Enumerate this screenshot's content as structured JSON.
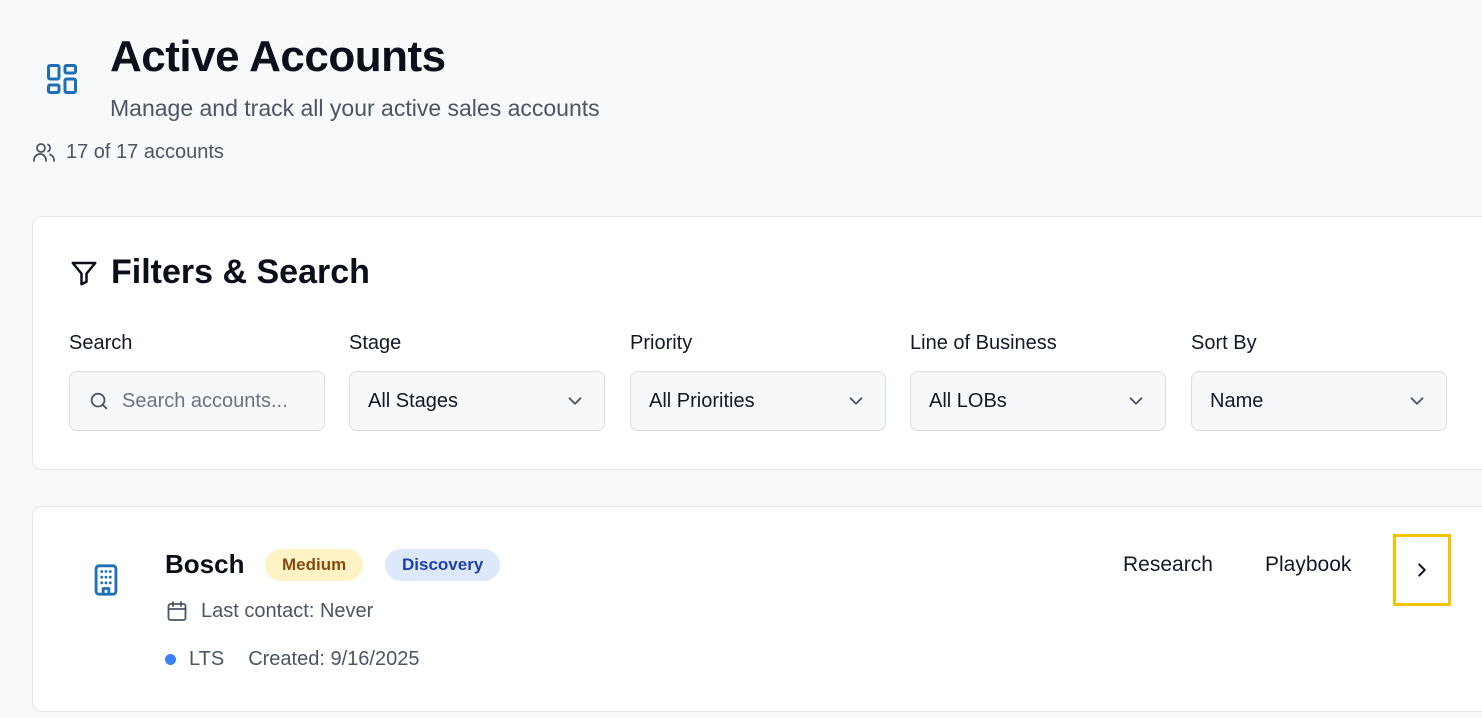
{
  "header": {
    "title": "Active Accounts",
    "subtitle": "Manage and track all your active sales accounts",
    "count_text": "17 of 17 accounts"
  },
  "filters": {
    "title": "Filters & Search",
    "search": {
      "label": "Search",
      "placeholder": "Search accounts..."
    },
    "stage": {
      "label": "Stage",
      "value": "All Stages"
    },
    "priority": {
      "label": "Priority",
      "value": "All Priorities"
    },
    "lob": {
      "label": "Line of Business",
      "value": "All LOBs"
    },
    "sort": {
      "label": "Sort By",
      "value": "Name"
    }
  },
  "accounts": [
    {
      "name": "Bosch",
      "priority": "Medium",
      "stage": "Discovery",
      "last_contact": "Last contact: Never",
      "lob": "LTS",
      "created": "Created: 9/16/2025",
      "actions": {
        "research": "Research",
        "playbook": "Playbook"
      }
    }
  ],
  "colors": {
    "accent": "#1d6fb8",
    "priority_medium_bg": "#fdf3c4",
    "stage_discovery_bg": "#dde9fb",
    "lob_dot": "#3b82f6",
    "highlight": "#f5c400"
  },
  "icons": {
    "header": "dashboard-grid-icon",
    "count": "users-icon",
    "filters": "filter-funnel-icon",
    "search": "search-icon",
    "dropdown": "chevron-down-icon",
    "account": "building-icon",
    "contact": "calendar-icon",
    "open": "chevron-right-icon"
  }
}
